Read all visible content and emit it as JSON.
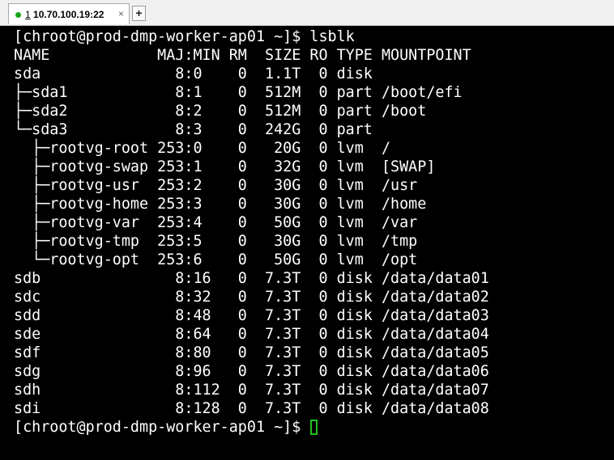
{
  "tab": {
    "index": "1",
    "title": " 10.70.100.19:22",
    "close_label": "×",
    "status_color": "#1aa31a"
  },
  "new_tab_label": "+",
  "terminal": {
    "lines": [
      "[chroot@prod-dmp-worker-ap01 ~]$ lsblk",
      "NAME            MAJ:MIN RM  SIZE RO TYPE MOUNTPOINT",
      "sda               8:0    0  1.1T  0 disk",
      "├─sda1            8:1    0  512M  0 part /boot/efi",
      "├─sda2            8:2    0  512M  0 part /boot",
      "└─sda3            8:3    0  242G  0 part",
      "  ├─rootvg-root 253:0    0   20G  0 lvm  /",
      "  ├─rootvg-swap 253:1    0   32G  0 lvm  [SWAP]",
      "  ├─rootvg-usr  253:2    0   30G  0 lvm  /usr",
      "  ├─rootvg-home 253:3    0   30G  0 lvm  /home",
      "  ├─rootvg-var  253:4    0   50G  0 lvm  /var",
      "  ├─rootvg-tmp  253:5    0   30G  0 lvm  /tmp",
      "  └─rootvg-opt  253:6    0   50G  0 lvm  /opt",
      "sdb               8:16   0  7.3T  0 disk /data/data01",
      "sdc               8:32   0  7.3T  0 disk /data/data02",
      "sdd               8:48   0  7.3T  0 disk /data/data03",
      "sde               8:64   0  7.3T  0 disk /data/data04",
      "sdf               8:80   0  7.3T  0 disk /data/data05",
      "sdg               8:96   0  7.3T  0 disk /data/data06",
      "sdh               8:112  0  7.3T  0 disk /data/data07",
      "sdi               8:128  0  7.3T  0 disk /data/data08"
    ],
    "prompt": "[chroot@prod-dmp-worker-ap01 ~]$ ",
    "cursor_color": "#1fc31f"
  }
}
